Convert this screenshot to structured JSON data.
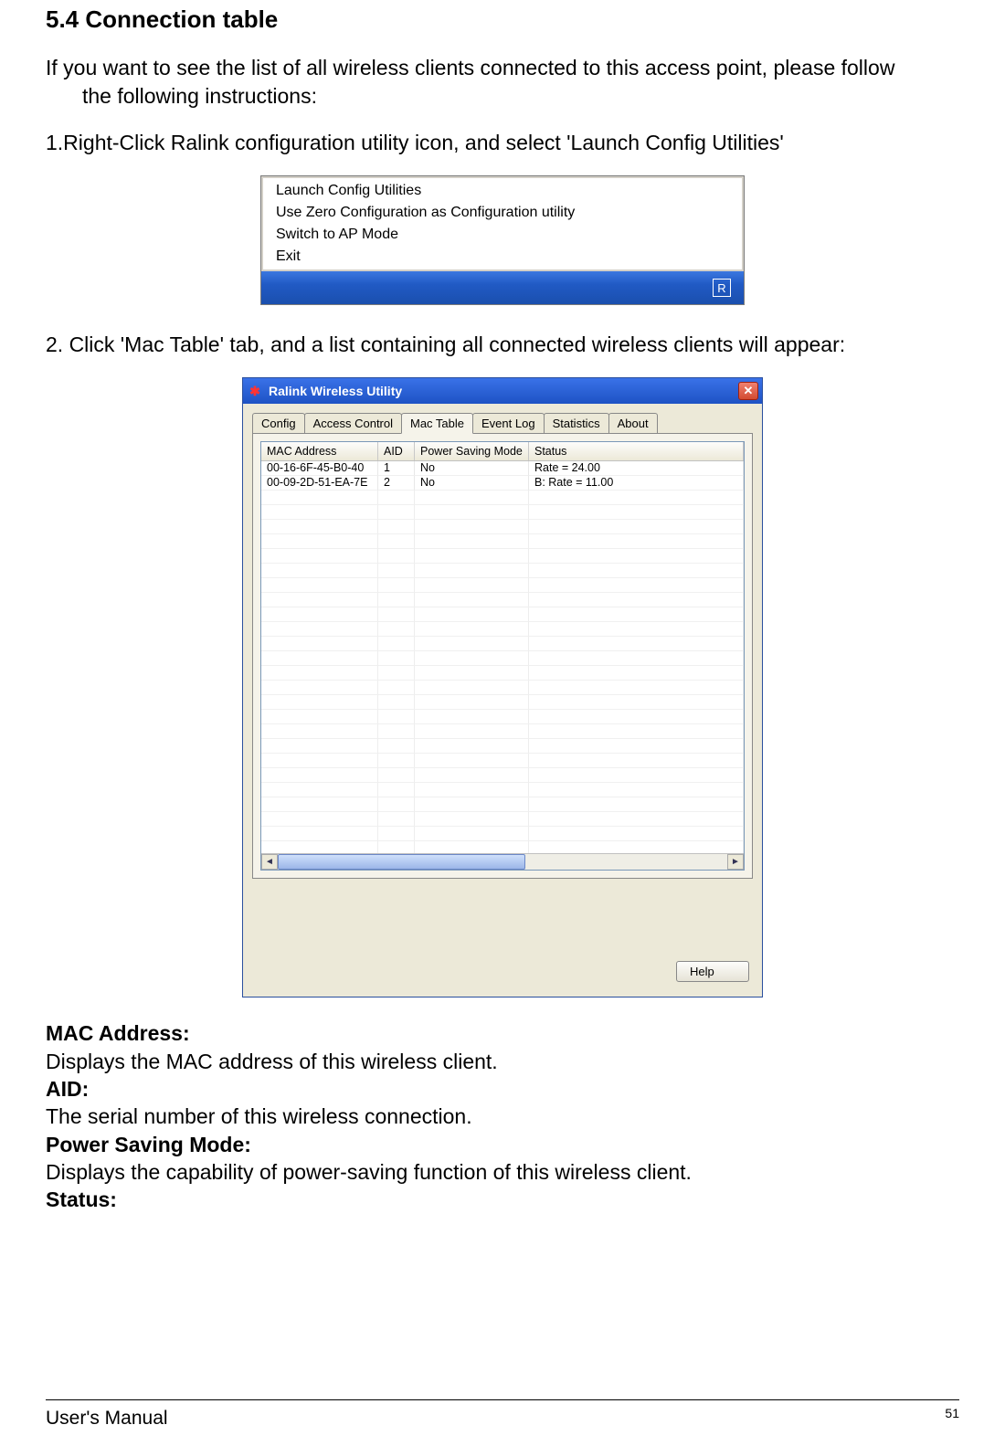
{
  "heading": "5.4  Connection table",
  "intro1": "If you want to see the list of all wireless clients connected to this access point, please follow",
  "intro2": "the following instructions:",
  "step1": "1.Right-Click Ralink configuration utility icon, and select 'Launch Config Utilities'",
  "ctx": {
    "items": [
      "Launch Config Utilities",
      "Use Zero Configuration as Configuration utility",
      "Switch to AP Mode",
      "Exit"
    ],
    "trayGlyph": "R"
  },
  "step2": "2. Click 'Mac Table' tab, and a list containing all connected wireless clients will appear:",
  "win": {
    "title": "Ralink Wireless Utility",
    "tabs": [
      "Config",
      "Access Control",
      "Mac Table",
      "Event Log",
      "Statistics",
      "About"
    ],
    "activeTab": 2,
    "columns": [
      "MAC Address",
      "AID",
      "Power Saving Mode",
      "Status"
    ],
    "rows": [
      {
        "mac": "00-16-6F-45-B0-40",
        "aid": "1",
        "psm": "No",
        "status": "Rate = 24.00"
      },
      {
        "mac": "00-09-2D-51-EA-7E",
        "aid": "2",
        "psm": "No",
        "status": "B: Rate = 11.00"
      }
    ],
    "helpLabel": "Help"
  },
  "defs": {
    "macLabel": "MAC Address:",
    "macDesc": "Displays the MAC address of this wireless client.",
    "aidLabel": "AID:",
    "aidDesc": "The serial number of this wireless connection.",
    "psmLabel": "Power Saving Mode:",
    "psmDesc": "Displays the capability of power-saving function of this wireless client.",
    "statusLabel": "Status:"
  },
  "footer": {
    "left": "User's Manual",
    "page": "51"
  }
}
